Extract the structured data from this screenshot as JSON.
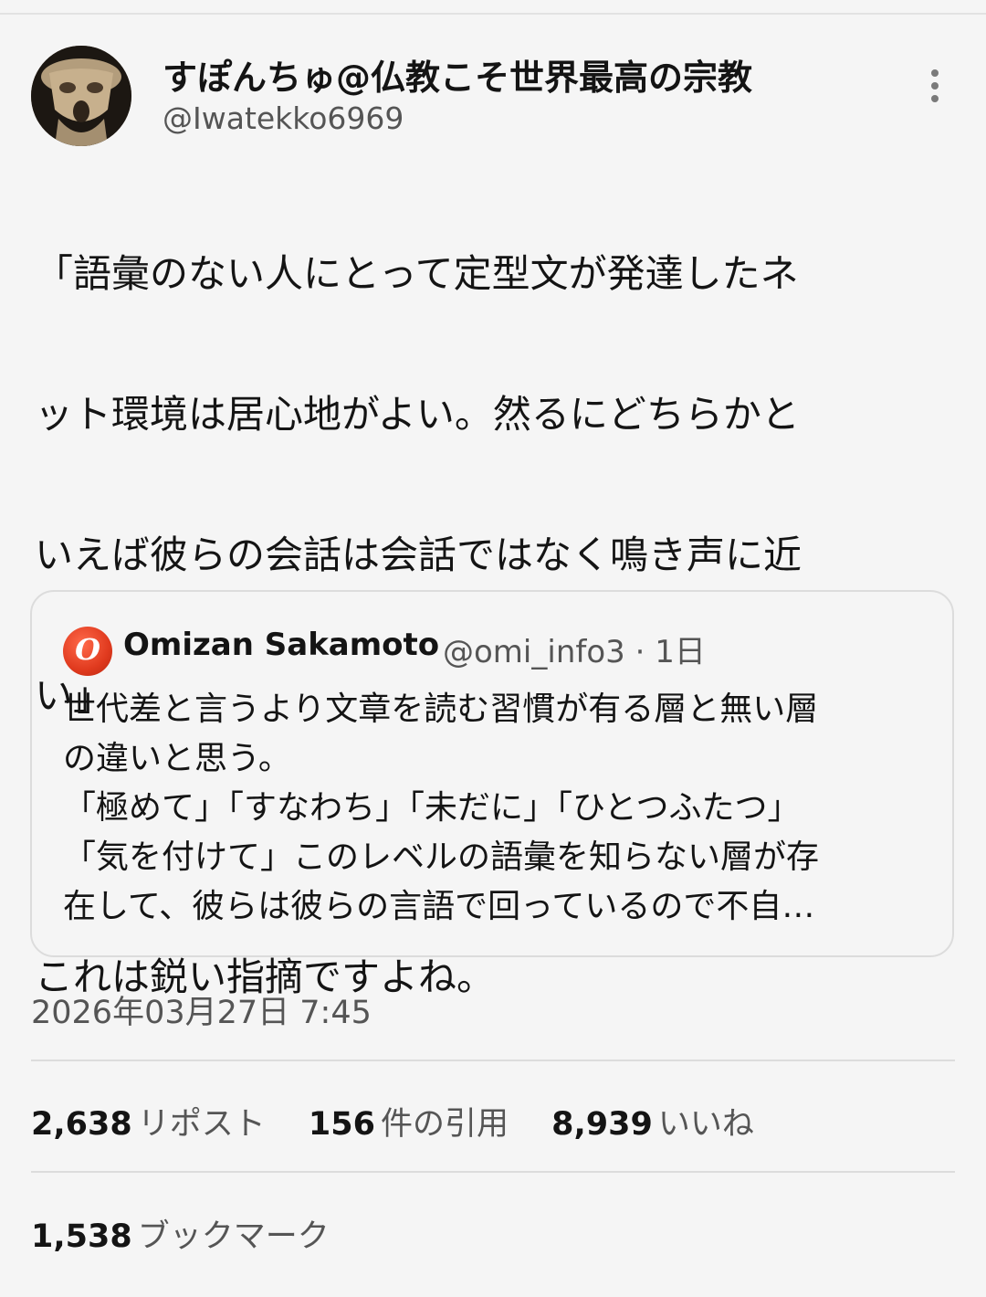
{
  "author": {
    "display_name": "すぽんちゅ@仏教こそ世界最高の宗教",
    "handle": "@Iwatekko6969",
    "avatar_icon": "clay-figure-avatar"
  },
  "more_icon": "more-vertical-icon",
  "tweet": {
    "lines": [
      "「語彙のない人にとって定型文が発達したネ",
      "ット環境は居心地がよい。然るにどちらかと",
      "いえば彼らの会話は会話ではなく鳴き声に近",
      "い」",
      "",
      "これは鋭い指摘ですよね。"
    ]
  },
  "quote": {
    "avatar_letter": "O",
    "name": "Omizan Sakamoto",
    "meta": "@omi_info3 · 1日",
    "lines": [
      "世代差と言うより文章を読む習慣が有る層と無い層",
      "の違いと思う。",
      "「極めて」「すなわち」「未だに」「ひとつふたつ」",
      "「気を付けて」このレベルの語彙を知らない層が存",
      "在して、彼らは彼らの言語で回っているので不自…"
    ]
  },
  "timestamp": "2026年03月27日 7:45",
  "stats": {
    "reposts": {
      "num": "2,638",
      "label": "リポスト"
    },
    "quotes": {
      "num": "156",
      "label": "件の引用"
    },
    "likes": {
      "num": "8,939",
      "label": "いいね"
    },
    "bookmarks": {
      "num": "1,538",
      "label": "ブックマーク"
    }
  },
  "colors": {
    "background": "#f5f5f5",
    "text": "#141414",
    "secondary_text": "#555555",
    "border": "#dcdcdc"
  }
}
